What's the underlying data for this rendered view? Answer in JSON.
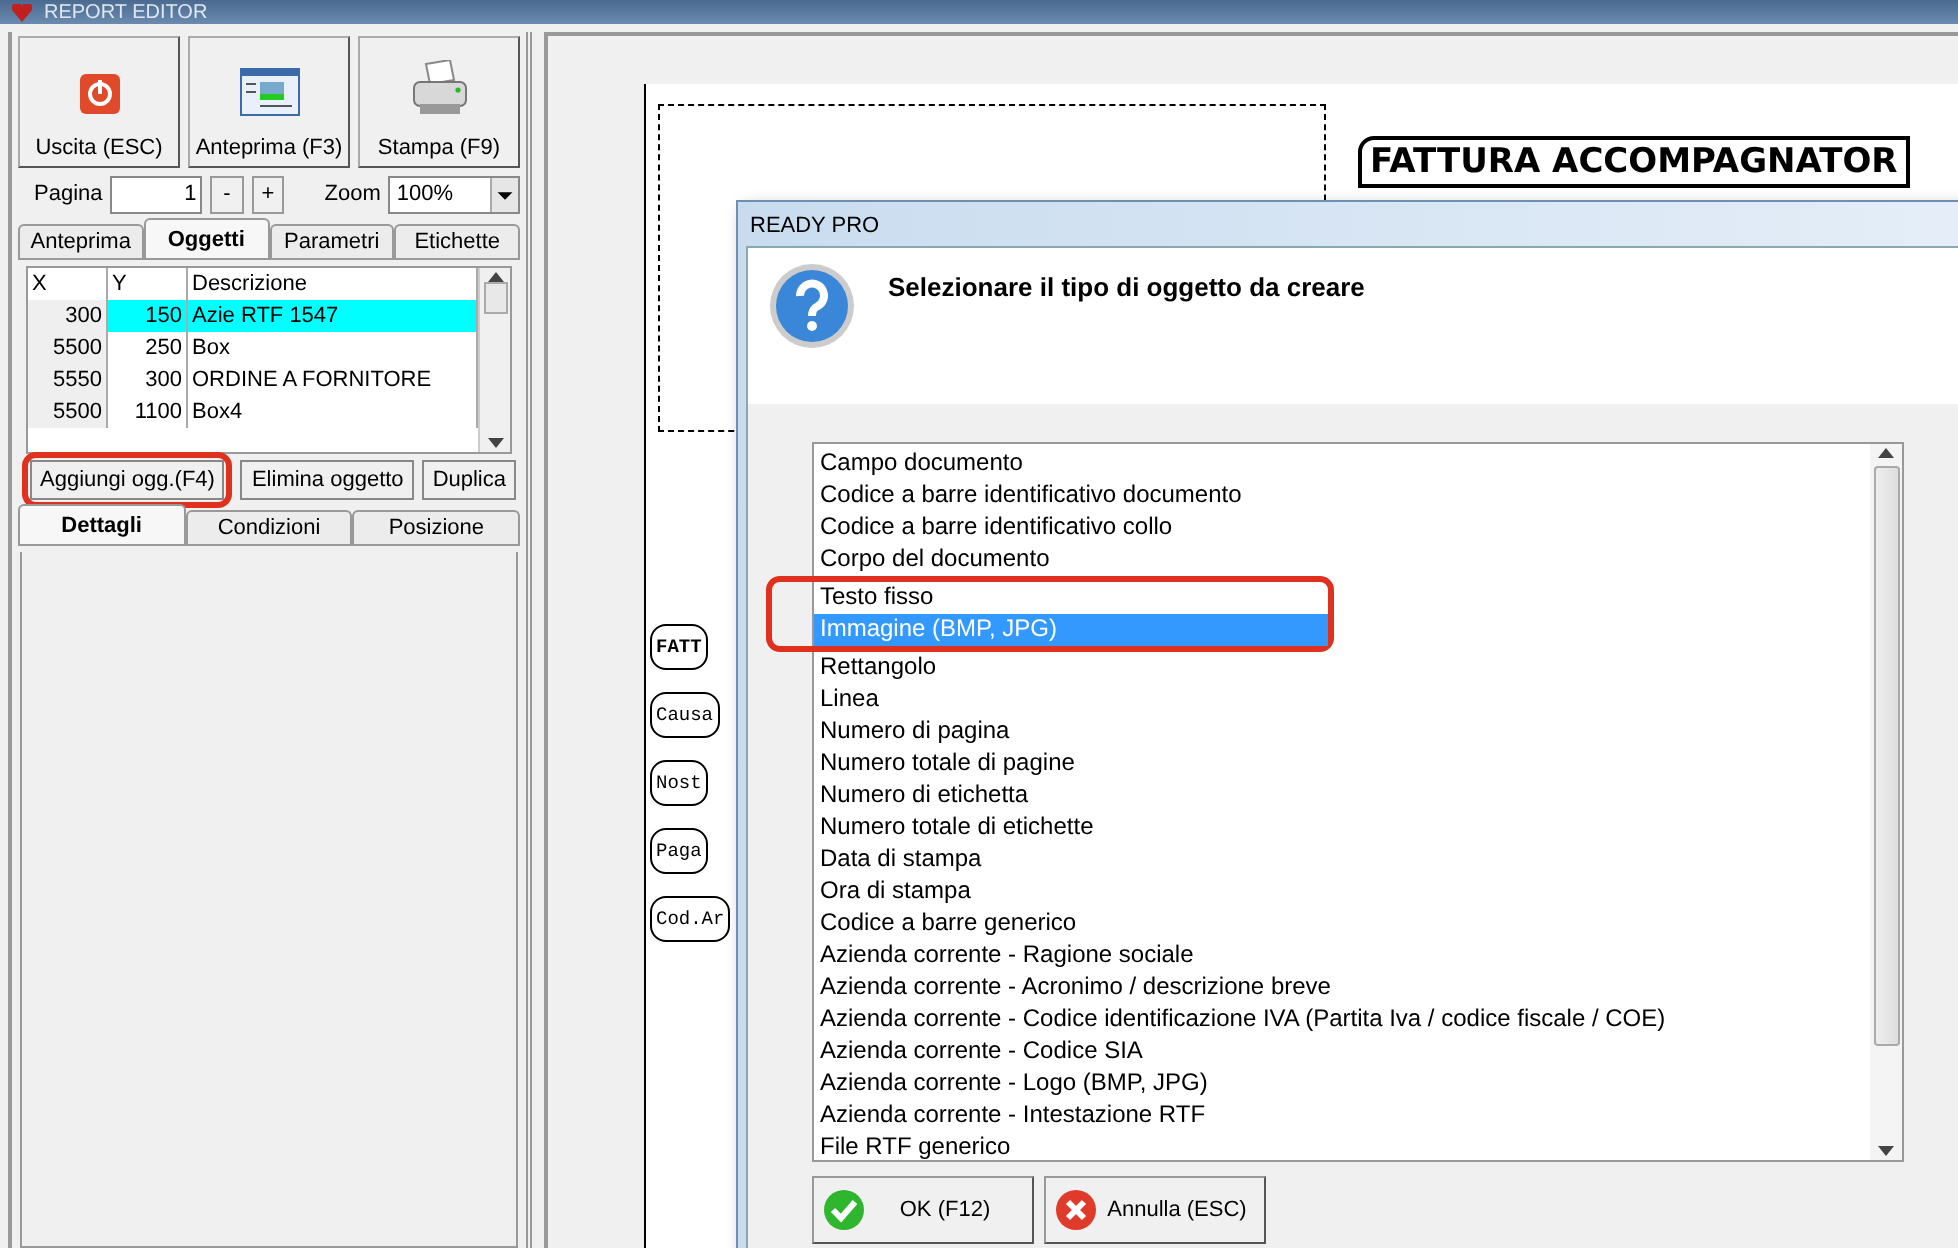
{
  "window": {
    "title": "REPORT EDITOR"
  },
  "toolbar": [
    {
      "label": "Uscita (ESC)",
      "kind": "power"
    },
    {
      "label": "Anteprima (F3)",
      "kind": "preview"
    },
    {
      "label": "Stampa (F9)",
      "kind": "printer"
    }
  ],
  "page": {
    "label": "Pagina",
    "value": "1",
    "minus": "-",
    "plus": "+"
  },
  "zoom": {
    "label": "Zoom",
    "value": "100%"
  },
  "tabs": [
    {
      "label": "Anteprima",
      "selected": false
    },
    {
      "label": "Oggetti",
      "selected": true
    },
    {
      "label": "Parametri",
      "selected": false
    },
    {
      "label": "Etichette",
      "selected": false
    }
  ],
  "objects_table": {
    "columns": [
      "X",
      "Y",
      "Descrizione"
    ],
    "rows": [
      {
        "cells": [
          "300",
          "150",
          "Azie RTF 1547"
        ],
        "selected": true
      },
      {
        "cells": [
          "5500",
          "250",
          "Box"
        ],
        "selected": false
      },
      {
        "cells": [
          "5550",
          "300",
          "ORDINE A FORNITORE"
        ],
        "selected": false
      },
      {
        "cells": [
          "5500",
          "1100",
          "Box4"
        ],
        "selected": false
      }
    ]
  },
  "object_buttons": [
    {
      "label": "Aggiungi ogg.(F4)",
      "annotated": true
    },
    {
      "label": "Elimina oggetto",
      "annotated": false
    },
    {
      "label": "Duplica",
      "annotated": false
    }
  ],
  "detail_tabs": [
    {
      "label": "Dettagli",
      "selected": true
    },
    {
      "label": "Condizioni",
      "selected": false
    },
    {
      "label": "Posizione",
      "selected": false
    }
  ],
  "document": {
    "title": "FATTURA ACCOMPAGNATOR",
    "fragments": [
      "FATT",
      "Causa",
      "Nost",
      "Paga",
      "Cod.Ar"
    ]
  },
  "dialog": {
    "title": "READY PRO",
    "message": "Selezionare il tipo di oggetto da creare",
    "items": [
      {
        "label": "Campo documento",
        "selected": false,
        "annotated": false
      },
      {
        "label": "Codice a barre identificativo documento",
        "selected": false,
        "annotated": false
      },
      {
        "label": "Codice a barre identificativo collo",
        "selected": false,
        "annotated": false
      },
      {
        "label": "Corpo del documento",
        "selected": false,
        "annotated": false
      },
      {
        "label": "Testo fisso",
        "selected": false,
        "annotated": true
      },
      {
        "label": "Immagine (BMP, JPG)",
        "selected": true,
        "annotated": true
      },
      {
        "label": "Rettangolo",
        "selected": false,
        "annotated": false
      },
      {
        "label": "Linea",
        "selected": false,
        "annotated": false
      },
      {
        "label": "Numero di pagina",
        "selected": false,
        "annotated": false
      },
      {
        "label": "Numero totale di pagine",
        "selected": false,
        "annotated": false
      },
      {
        "label": "Numero di etichetta",
        "selected": false,
        "annotated": false
      },
      {
        "label": "Numero totale di etichette",
        "selected": false,
        "annotated": false
      },
      {
        "label": "Data di stampa",
        "selected": false,
        "annotated": false
      },
      {
        "label": "Ora di stampa",
        "selected": false,
        "annotated": false
      },
      {
        "label": "Codice a barre generico",
        "selected": false,
        "annotated": false
      },
      {
        "label": "Azienda corrente - Ragione sociale",
        "selected": false,
        "annotated": false
      },
      {
        "label": "Azienda corrente - Acronimo / descrizione breve",
        "selected": false,
        "annotated": false
      },
      {
        "label": "Azienda corrente - Codice identificazione IVA (Partita Iva / codice fiscale / COE)",
        "selected": false,
        "annotated": false
      },
      {
        "label": "Azienda corrente - Codice SIA",
        "selected": false,
        "annotated": false
      },
      {
        "label": "Azienda corrente - Logo (BMP, JPG)",
        "selected": false,
        "annotated": false
      },
      {
        "label": "Azienda corrente - Intestazione RTF",
        "selected": false,
        "annotated": false
      },
      {
        "label": "File RTF generico",
        "selected": false,
        "annotated": false
      }
    ],
    "buttons": [
      {
        "label": "OK (F12)",
        "kind": "ok"
      },
      {
        "label": "Annulla (ESC)",
        "kind": "cancel"
      }
    ]
  }
}
